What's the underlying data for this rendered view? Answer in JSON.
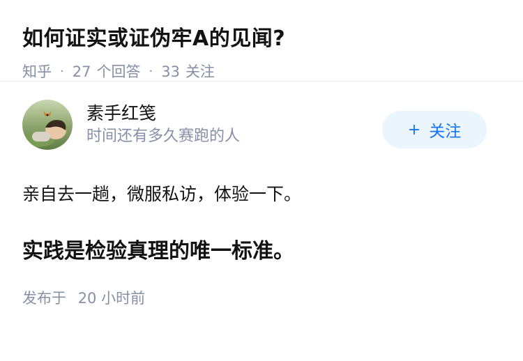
{
  "question": {
    "title": "如何证实或证伪牢A的见闻?",
    "source": "知乎",
    "separator": "·",
    "answer_count": "27",
    "answer_label": "个回答",
    "follow_count": "33",
    "follow_label": "关注"
  },
  "answer": {
    "author_name": "素手红笺",
    "author_bio": "时间还有多久赛跑的人",
    "follow_button_plus": "+",
    "follow_button_label": "关注",
    "paragraphs": [
      "亲自去一趟，微服私访，体验一下。",
      "实践是检验真理的唯一标准。"
    ],
    "publish_prefix": "发布于",
    "publish_time": "20 小时前"
  },
  "colors": {
    "accent": "#1772f6",
    "follow_bg": "#ebf5fd",
    "meta_gray": "#8590a6",
    "text": "#121212"
  }
}
